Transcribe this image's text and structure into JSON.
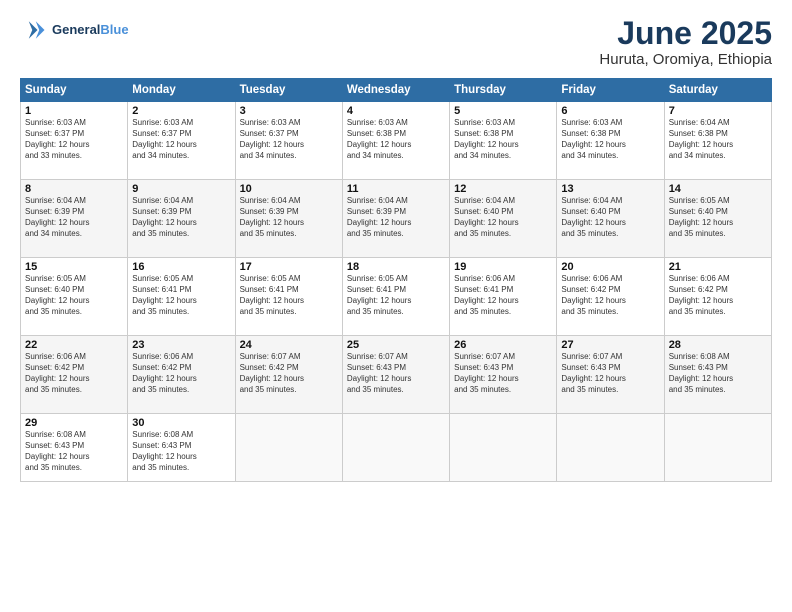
{
  "header": {
    "logo_line1": "General",
    "logo_line2": "Blue",
    "month": "June 2025",
    "location": "Huruta, Oromiya, Ethiopia"
  },
  "days_of_week": [
    "Sunday",
    "Monday",
    "Tuesday",
    "Wednesday",
    "Thursday",
    "Friday",
    "Saturday"
  ],
  "weeks": [
    [
      {
        "day": "1",
        "text": "Sunrise: 6:03 AM\nSunset: 6:37 PM\nDaylight: 12 hours\nand 33 minutes."
      },
      {
        "day": "2",
        "text": "Sunrise: 6:03 AM\nSunset: 6:37 PM\nDaylight: 12 hours\nand 34 minutes."
      },
      {
        "day": "3",
        "text": "Sunrise: 6:03 AM\nSunset: 6:37 PM\nDaylight: 12 hours\nand 34 minutes."
      },
      {
        "day": "4",
        "text": "Sunrise: 6:03 AM\nSunset: 6:38 PM\nDaylight: 12 hours\nand 34 minutes."
      },
      {
        "day": "5",
        "text": "Sunrise: 6:03 AM\nSunset: 6:38 PM\nDaylight: 12 hours\nand 34 minutes."
      },
      {
        "day": "6",
        "text": "Sunrise: 6:03 AM\nSunset: 6:38 PM\nDaylight: 12 hours\nand 34 minutes."
      },
      {
        "day": "7",
        "text": "Sunrise: 6:04 AM\nSunset: 6:38 PM\nDaylight: 12 hours\nand 34 minutes."
      }
    ],
    [
      {
        "day": "8",
        "text": "Sunrise: 6:04 AM\nSunset: 6:39 PM\nDaylight: 12 hours\nand 34 minutes."
      },
      {
        "day": "9",
        "text": "Sunrise: 6:04 AM\nSunset: 6:39 PM\nDaylight: 12 hours\nand 35 minutes."
      },
      {
        "day": "10",
        "text": "Sunrise: 6:04 AM\nSunset: 6:39 PM\nDaylight: 12 hours\nand 35 minutes."
      },
      {
        "day": "11",
        "text": "Sunrise: 6:04 AM\nSunset: 6:39 PM\nDaylight: 12 hours\nand 35 minutes."
      },
      {
        "day": "12",
        "text": "Sunrise: 6:04 AM\nSunset: 6:40 PM\nDaylight: 12 hours\nand 35 minutes."
      },
      {
        "day": "13",
        "text": "Sunrise: 6:04 AM\nSunset: 6:40 PM\nDaylight: 12 hours\nand 35 minutes."
      },
      {
        "day": "14",
        "text": "Sunrise: 6:05 AM\nSunset: 6:40 PM\nDaylight: 12 hours\nand 35 minutes."
      }
    ],
    [
      {
        "day": "15",
        "text": "Sunrise: 6:05 AM\nSunset: 6:40 PM\nDaylight: 12 hours\nand 35 minutes."
      },
      {
        "day": "16",
        "text": "Sunrise: 6:05 AM\nSunset: 6:41 PM\nDaylight: 12 hours\nand 35 minutes."
      },
      {
        "day": "17",
        "text": "Sunrise: 6:05 AM\nSunset: 6:41 PM\nDaylight: 12 hours\nand 35 minutes."
      },
      {
        "day": "18",
        "text": "Sunrise: 6:05 AM\nSunset: 6:41 PM\nDaylight: 12 hours\nand 35 minutes."
      },
      {
        "day": "19",
        "text": "Sunrise: 6:06 AM\nSunset: 6:41 PM\nDaylight: 12 hours\nand 35 minutes."
      },
      {
        "day": "20",
        "text": "Sunrise: 6:06 AM\nSunset: 6:42 PM\nDaylight: 12 hours\nand 35 minutes."
      },
      {
        "day": "21",
        "text": "Sunrise: 6:06 AM\nSunset: 6:42 PM\nDaylight: 12 hours\nand 35 minutes."
      }
    ],
    [
      {
        "day": "22",
        "text": "Sunrise: 6:06 AM\nSunset: 6:42 PM\nDaylight: 12 hours\nand 35 minutes."
      },
      {
        "day": "23",
        "text": "Sunrise: 6:06 AM\nSunset: 6:42 PM\nDaylight: 12 hours\nand 35 minutes."
      },
      {
        "day": "24",
        "text": "Sunrise: 6:07 AM\nSunset: 6:42 PM\nDaylight: 12 hours\nand 35 minutes."
      },
      {
        "day": "25",
        "text": "Sunrise: 6:07 AM\nSunset: 6:43 PM\nDaylight: 12 hours\nand 35 minutes."
      },
      {
        "day": "26",
        "text": "Sunrise: 6:07 AM\nSunset: 6:43 PM\nDaylight: 12 hours\nand 35 minutes."
      },
      {
        "day": "27",
        "text": "Sunrise: 6:07 AM\nSunset: 6:43 PM\nDaylight: 12 hours\nand 35 minutes."
      },
      {
        "day": "28",
        "text": "Sunrise: 6:08 AM\nSunset: 6:43 PM\nDaylight: 12 hours\nand 35 minutes."
      }
    ],
    [
      {
        "day": "29",
        "text": "Sunrise: 6:08 AM\nSunset: 6:43 PM\nDaylight: 12 hours\nand 35 minutes."
      },
      {
        "day": "30",
        "text": "Sunrise: 6:08 AM\nSunset: 6:43 PM\nDaylight: 12 hours\nand 35 minutes."
      },
      {
        "day": "",
        "text": ""
      },
      {
        "day": "",
        "text": ""
      },
      {
        "day": "",
        "text": ""
      },
      {
        "day": "",
        "text": ""
      },
      {
        "day": "",
        "text": ""
      }
    ]
  ]
}
